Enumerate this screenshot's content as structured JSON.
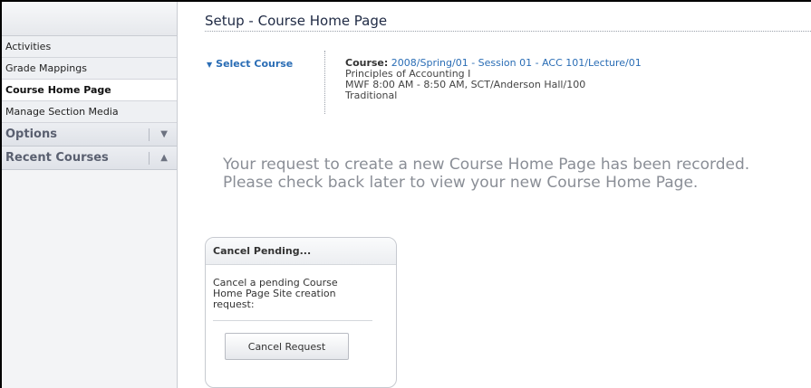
{
  "sidebar": {
    "items": [
      {
        "label": "Activities"
      },
      {
        "label": "Grade Mappings"
      },
      {
        "label": "Course Home Page",
        "active": true
      },
      {
        "label": "Manage Section Media"
      }
    ],
    "sections": [
      {
        "label": "Options",
        "icon": "triangle-down-icon",
        "glyph": "▼"
      },
      {
        "label": "Recent Courses",
        "icon": "triangle-up-icon",
        "glyph": "▲"
      }
    ]
  },
  "main": {
    "title": "Setup - Course Home Page",
    "select_course": {
      "glyph": "▼",
      "label": "Select Course"
    },
    "course": {
      "label": "Course:",
      "value": "2008/Spring/01 - Session 01 - ACC 101/Lecture/01",
      "name": "Principles of Accounting I",
      "schedule": "MWF 8:00 AM - 8:50 AM, SCT/Anderson Hall/100",
      "mode": "Traditional"
    },
    "message": {
      "line1": "Your request to create a new Course Home Page has been recorded.",
      "line2": "Please check back later to view your new Course Home Page."
    },
    "cancel_box": {
      "title": "Cancel Pending...",
      "text": "Cancel a pending Course Home Page Site creation request:",
      "button_label": "Cancel Request"
    }
  },
  "colors": {
    "link": "#2a6db5",
    "message": "#8a8e96",
    "sidebar_bg": "#f3f4f6"
  }
}
